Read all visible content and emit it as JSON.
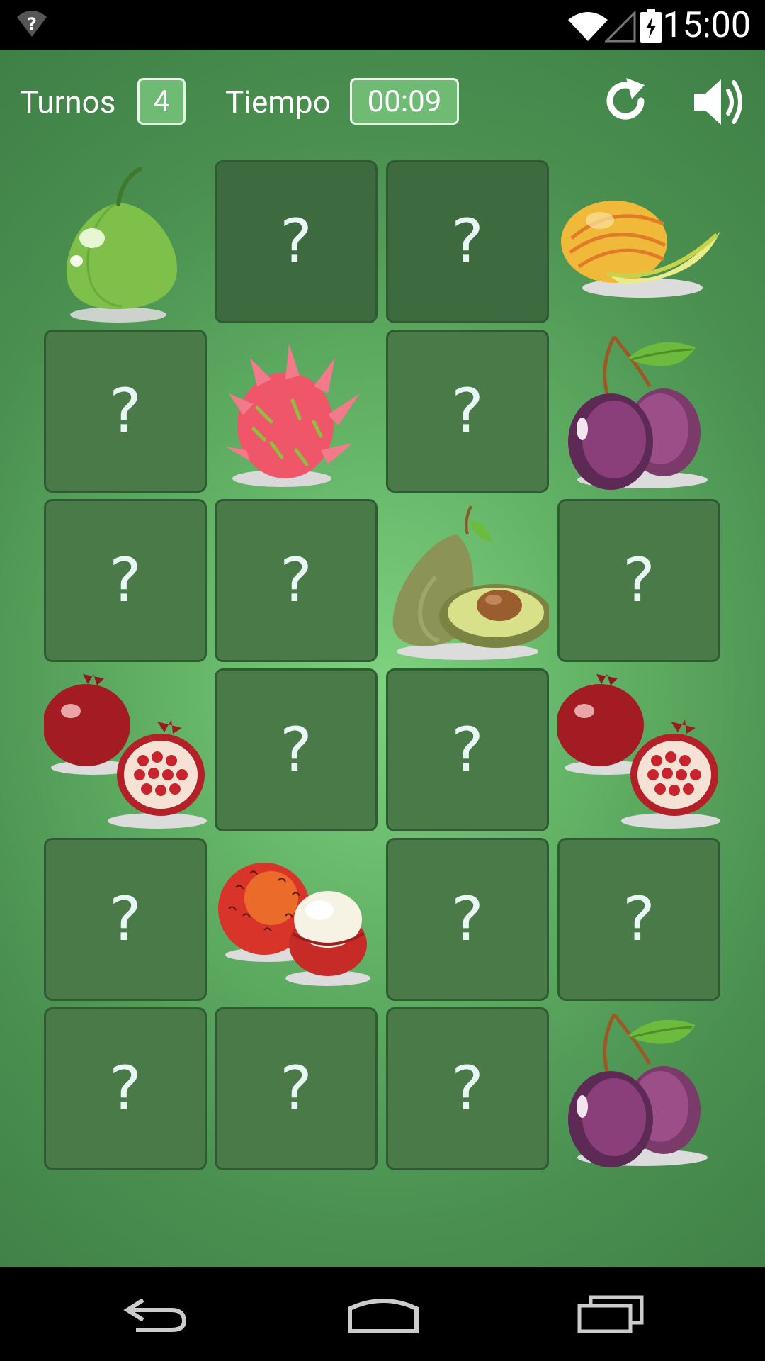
{
  "status": {
    "time": "15:00"
  },
  "hud": {
    "turns_label": "Turnos",
    "turns_value": "4",
    "time_label": "Tiempo",
    "time_value": "00:09"
  },
  "board": {
    "rows": 6,
    "cols": 4,
    "hidden_symbol": "?",
    "cards": [
      {
        "state": "revealed",
        "fruit": "guava"
      },
      {
        "state": "hidden"
      },
      {
        "state": "hidden"
      },
      {
        "state": "revealed",
        "fruit": "melon"
      },
      {
        "state": "hidden"
      },
      {
        "state": "revealed",
        "fruit": "dragon-fruit"
      },
      {
        "state": "hidden"
      },
      {
        "state": "revealed",
        "fruit": "plum"
      },
      {
        "state": "hidden"
      },
      {
        "state": "hidden"
      },
      {
        "state": "revealed",
        "fruit": "avocado"
      },
      {
        "state": "hidden"
      },
      {
        "state": "revealed",
        "fruit": "pomegranate"
      },
      {
        "state": "hidden"
      },
      {
        "state": "hidden"
      },
      {
        "state": "revealed",
        "fruit": "pomegranate"
      },
      {
        "state": "hidden"
      },
      {
        "state": "revealed",
        "fruit": "rambutan"
      },
      {
        "state": "hidden"
      },
      {
        "state": "hidden"
      },
      {
        "state": "hidden"
      },
      {
        "state": "hidden"
      },
      {
        "state": "hidden"
      },
      {
        "state": "revealed",
        "fruit": "plum"
      }
    ]
  },
  "colors": {
    "card_hidden": "#4a7a47",
    "card_border": "#2f5b33",
    "hud_box": "#6fbb74"
  }
}
